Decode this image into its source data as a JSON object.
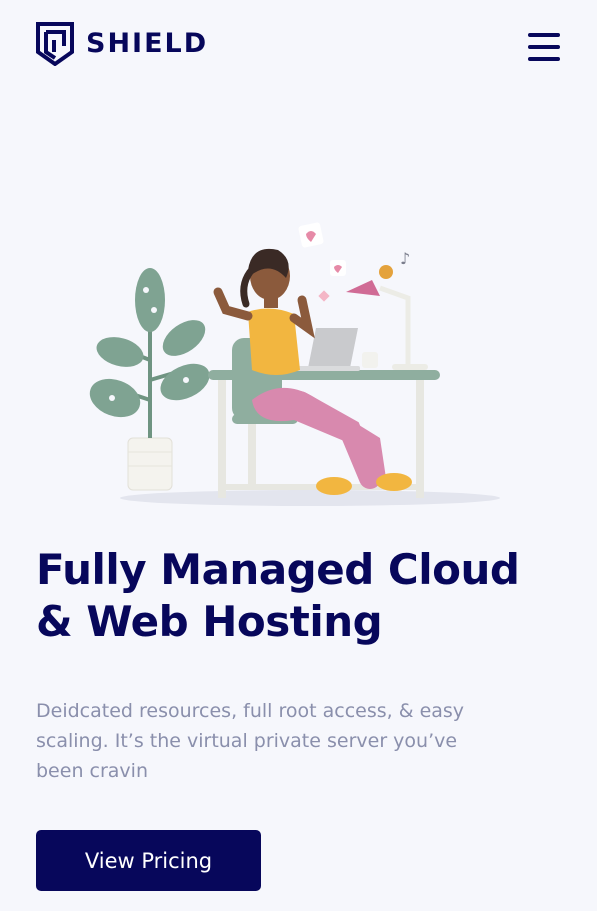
{
  "brand": {
    "name": "SHIELD",
    "logo_icon": "shield-logo-icon",
    "color": "#07075b"
  },
  "header": {
    "menu_icon": "hamburger-menu-icon"
  },
  "hero": {
    "illustration": "woman-at-desk-with-laptop-illustration",
    "title_line1": "Fully Managed Cloud",
    "title_line2": "& Web Hosting",
    "description": "Deidcated resources, full root access, & easy scaling. It’s the virtual private server you’ve been cravin",
    "cta_label": "View Pricing"
  },
  "colors": {
    "background": "#f6f7fc",
    "primary": "#07075b",
    "muted_text": "#8a8fac"
  }
}
